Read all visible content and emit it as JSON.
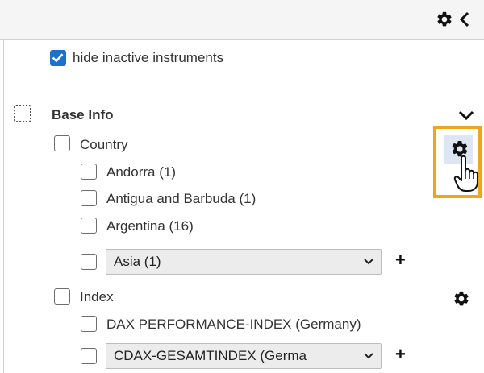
{
  "toolbar": {
    "settings_icon": "gear-icon",
    "collapse_icon": "chevron-left-icon"
  },
  "filter": {
    "hide_inactive_label": "hide inactive instruments",
    "hide_inactive_checked": true
  },
  "base_info": {
    "title": "Base Info",
    "expand_icon": "chevron-down-icon",
    "country": {
      "label": "Country",
      "items": [
        "Andorra (1)",
        "Antigua and Barbuda (1)",
        "Argentina (16)"
      ],
      "select_value": "Asia (1)"
    },
    "index": {
      "label": "Index",
      "items": [
        "DAX PERFORMANCE-INDEX (Germany)"
      ],
      "select_value": "CDAX-GESAMTINDEX (Germa"
    },
    "add_symbol": "+"
  },
  "colors": {
    "accent": "#1f6fcf",
    "highlight": "#f0a61a"
  }
}
